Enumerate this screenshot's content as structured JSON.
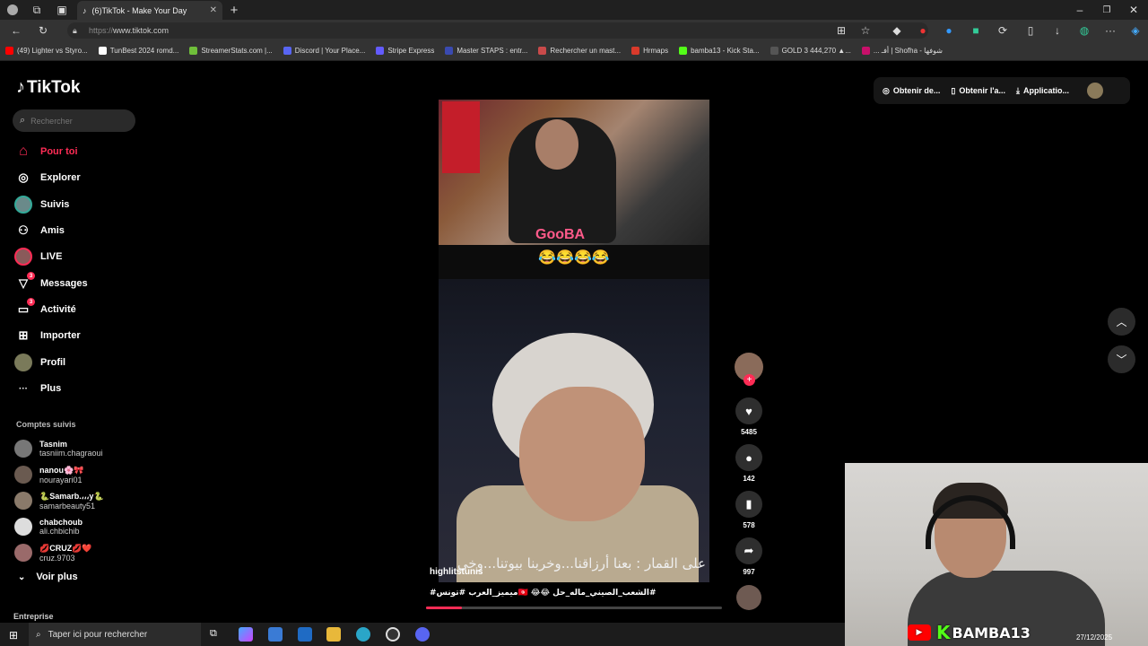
{
  "browser": {
    "tab_title": "(6)TikTok - Make Your Day",
    "new_tab_label": "+",
    "url_protocol": "https://",
    "url_domain": "www.tiktok.com",
    "bookmarks": [
      {
        "label": "(49) Lighter vs Styro...",
        "color": "#ff0000"
      },
      {
        "label": "TunBest 2024 romd...",
        "color": "#ffffff"
      },
      {
        "label": "StreamerStats.com |...",
        "color": "#6fbf3a"
      },
      {
        "label": "Discord | Your Place...",
        "color": "#5865f2"
      },
      {
        "label": "Stripe Express",
        "color": "#635bff"
      },
      {
        "label": "Master STAPS : entr...",
        "color": "#3a4ab0"
      },
      {
        "label": "Rechercher un mast...",
        "color": "#c94a4a"
      },
      {
        "label": "Hrmaps",
        "color": "#d93a2b"
      },
      {
        "label": "bamba13 - Kick Sta...",
        "color": "#53fc18"
      },
      {
        "label": "GOLD 3 444,270 ▲...",
        "color": "#222222"
      },
      {
        "label": "... أفـ | Shofha - شوفها",
        "color": "#c8106a"
      }
    ]
  },
  "tiktok": {
    "logo": "TikTok",
    "search_placeholder": "Rechercher",
    "nav": [
      {
        "label": "Pour toi",
        "icon": "home-icon",
        "glyph": "⌂"
      },
      {
        "label": "Explorer",
        "icon": "compass-icon",
        "glyph": "◎"
      },
      {
        "label": "Suivis",
        "icon": "following-avatar-icon",
        "glyph": ""
      },
      {
        "label": "Amis",
        "icon": "friends-icon",
        "glyph": "⚇"
      },
      {
        "label": "LIVE",
        "icon": "live-avatar-icon",
        "glyph": ""
      },
      {
        "label": "Messages",
        "icon": "messages-icon",
        "glyph": "▽",
        "badge": "3"
      },
      {
        "label": "Activité",
        "icon": "activity-icon",
        "glyph": "▭",
        "badge": "3"
      },
      {
        "label": "Importer",
        "icon": "upload-icon",
        "glyph": "⊞"
      },
      {
        "label": "Profil",
        "icon": "profile-avatar-icon",
        "glyph": ""
      },
      {
        "label": "Plus",
        "icon": "more-icon",
        "glyph": "···"
      }
    ],
    "following_title": "Comptes suivis",
    "accounts": [
      {
        "name": "Tasnim",
        "handle": "tasniim.chagraoui"
      },
      {
        "name": "nanou🌸🎀",
        "handle": "nourayari01"
      },
      {
        "name": "🐍Samarb.،،،y🐍",
        "handle": "samarbeauty51"
      },
      {
        "name": "chabchoub",
        "handle": "ali.chbichib"
      },
      {
        "name": "💋CRUZ💋❤️",
        "handle": "cruz.9703"
      }
    ],
    "see_more": "Voir plus",
    "enterprise": "Entreprise",
    "top_buttons": [
      "Obtenir de...",
      "Obtenir l'a...",
      "Applicatio..."
    ],
    "video": {
      "overlay_emojis": "😂😂😂😂",
      "subtitle": "على القمار : بعنا أرزاقنا...وخربنا بيوتنا...وخي",
      "author": "highlitstunis",
      "caption": "#ميميز_العرب #تونس🇹🇳 😂😂 الشعب_الصيني_ماله_حل#",
      "neon_text": "GooBA",
      "progress": 0.12
    },
    "actions": {
      "likes": "5485",
      "comments": "142",
      "saves": "578",
      "shares": "997"
    },
    "accent_color": "#fe2c55"
  },
  "overlay": {
    "streamer_name": "BAMBA13",
    "kick_letter": "K",
    "youtube_label": "▶"
  },
  "taskbar": {
    "search_placeholder": "Taper ici pour rechercher",
    "date": "27/12/2025"
  }
}
